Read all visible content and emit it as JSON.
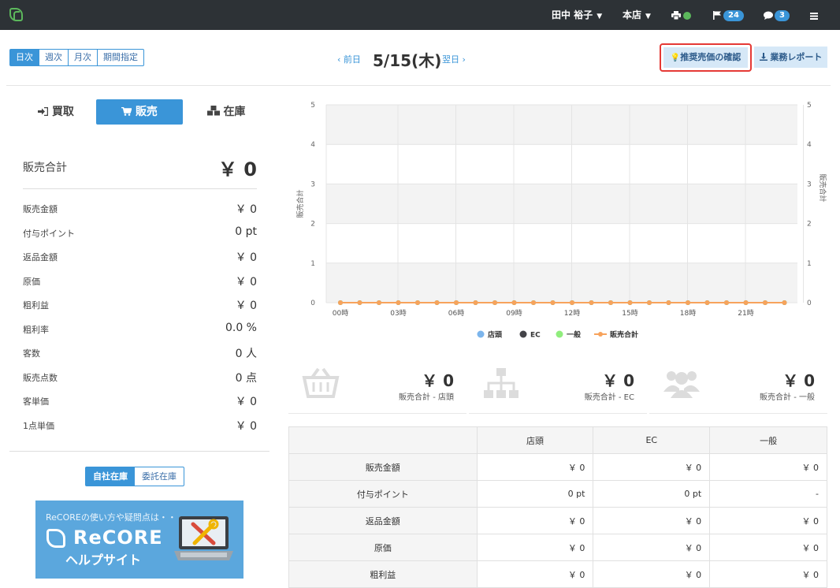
{
  "topbar": {
    "user": "田中 裕子",
    "store": "本店",
    "flag_count": "24",
    "chat_count": "3"
  },
  "period_tabs": [
    "日次",
    "週次",
    "月次",
    "期間指定"
  ],
  "date_nav": {
    "prev": "‹ 前日",
    "current": "5/15(木)",
    "next": "翌日 ›"
  },
  "actions": {
    "recommend": "推奨売価の確認",
    "report": "業務レポート"
  },
  "mode_tabs": {
    "buy": "買取",
    "sell": "販売",
    "stock": "在庫"
  },
  "summary": {
    "label": "販売合計",
    "value": "￥ 0"
  },
  "rows": [
    {
      "label": "販売金額",
      "value": "￥ 0"
    },
    {
      "label": "付与ポイント",
      "value": "0 pt"
    },
    {
      "label": "返品金額",
      "value": "￥ 0"
    },
    {
      "label": "原価",
      "value": "￥ 0"
    },
    {
      "label": "粗利益",
      "value": "￥ 0"
    },
    {
      "label": "粗利率",
      "value": "0.0 %"
    },
    {
      "label": "客数",
      "value": "0 人"
    },
    {
      "label": "販売点数",
      "value": "0 点"
    },
    {
      "label": "客単価",
      "value": "￥ 0"
    },
    {
      "label": "1点単価",
      "value": "￥ 0"
    }
  ],
  "stock_toggle": [
    "自社在庫",
    "委託在庫"
  ],
  "banner": {
    "small": "ReCOREの使い方や疑問点は・・・",
    "brand": "ReCORE",
    "help": "ヘルプサイト"
  },
  "chart_data": {
    "type": "line",
    "x": [
      "00時",
      "01時",
      "02時",
      "03時",
      "04時",
      "05時",
      "06時",
      "07時",
      "08時",
      "09時",
      "10時",
      "11時",
      "12時",
      "13時",
      "14時",
      "15時",
      "16時",
      "17時",
      "18時",
      "19時",
      "20時",
      "21時",
      "22時",
      "23時"
    ],
    "xtick_labels": [
      "00時",
      "03時",
      "06時",
      "09時",
      "12時",
      "15時",
      "18時",
      "21時"
    ],
    "series": [
      {
        "name": "店頭",
        "values": [
          0,
          0,
          0,
          0,
          0,
          0,
          0,
          0,
          0,
          0,
          0,
          0,
          0,
          0,
          0,
          0,
          0,
          0,
          0,
          0,
          0,
          0,
          0,
          0
        ],
        "color": "#7cb5ec"
      },
      {
        "name": "EC",
        "values": [
          0,
          0,
          0,
          0,
          0,
          0,
          0,
          0,
          0,
          0,
          0,
          0,
          0,
          0,
          0,
          0,
          0,
          0,
          0,
          0,
          0,
          0,
          0,
          0
        ],
        "color": "#434348"
      },
      {
        "name": "一般",
        "values": [
          0,
          0,
          0,
          0,
          0,
          0,
          0,
          0,
          0,
          0,
          0,
          0,
          0,
          0,
          0,
          0,
          0,
          0,
          0,
          0,
          0,
          0,
          0,
          0
        ],
        "color": "#90ed7d"
      },
      {
        "name": "販売合計",
        "values": [
          0,
          0,
          0,
          0,
          0,
          0,
          0,
          0,
          0,
          0,
          0,
          0,
          0,
          0,
          0,
          0,
          0,
          0,
          0,
          0,
          0,
          0,
          0,
          0
        ],
        "color": "#f7a35c"
      }
    ],
    "ylabel": "販売合計",
    "ylabel_right": "販売合計",
    "ylim": [
      0,
      5
    ],
    "yticks": [
      0,
      1,
      2,
      3,
      4,
      5
    ],
    "legend_position": "bottom",
    "grid": true
  },
  "cards": [
    {
      "value": "￥ 0",
      "label": "販売合計 - 店頭"
    },
    {
      "value": "￥ 0",
      "label": "販売合計 - EC"
    },
    {
      "value": "￥ 0",
      "label": "販売合計 - 一般"
    }
  ],
  "table": {
    "headers": [
      "",
      "店頭",
      "EC",
      "一般"
    ],
    "rows": [
      [
        "販売金額",
        "￥ 0",
        "￥ 0",
        "￥ 0"
      ],
      [
        "付与ポイント",
        "0 pt",
        "0 pt",
        "-"
      ],
      [
        "返品金額",
        "￥ 0",
        "￥ 0",
        "￥ 0"
      ],
      [
        "原価",
        "￥ 0",
        "￥ 0",
        "￥ 0"
      ],
      [
        "粗利益",
        "￥ 0",
        "￥ 0",
        "￥ 0"
      ]
    ]
  },
  "colors": {
    "accent": "#3a95d8",
    "topbar": "#2d3236",
    "highlight": "#e53935"
  }
}
